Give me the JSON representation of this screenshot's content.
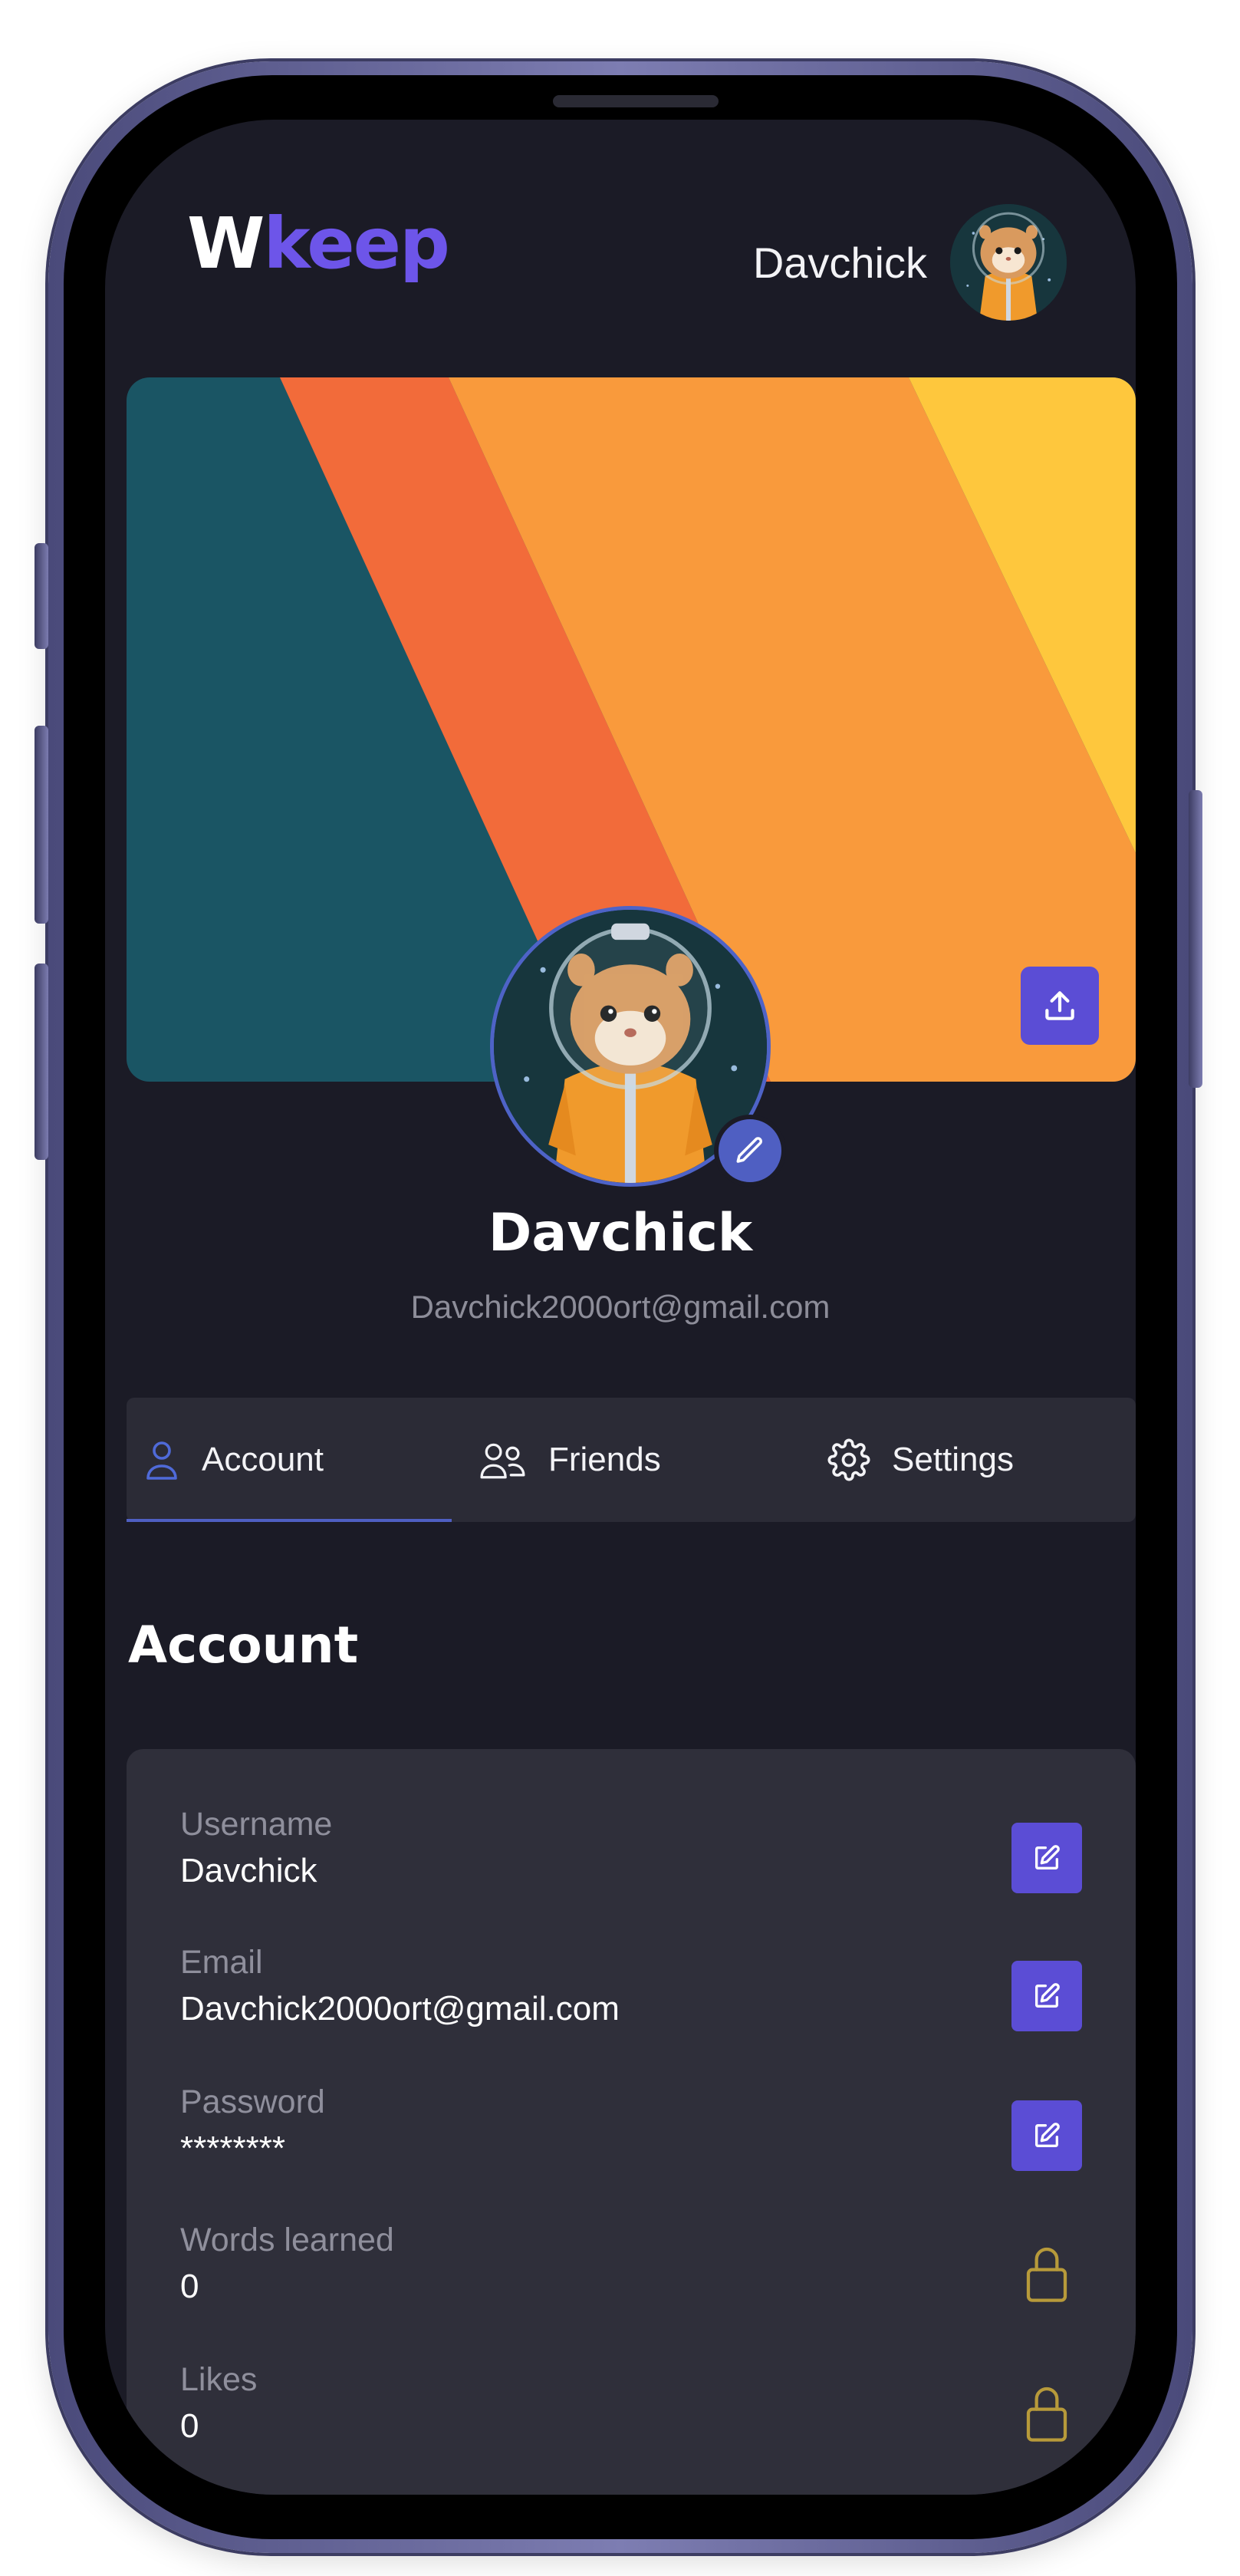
{
  "header": {
    "logo_part1": "W",
    "logo_part2": "keep",
    "username": "Davchick"
  },
  "banner": {
    "upload_icon": "upload-icon"
  },
  "profile": {
    "name": "Davchick",
    "email": "Davchick2000ort@gmail.com",
    "edit_icon": "pencil-icon"
  },
  "tabs": [
    {
      "label": "Account",
      "icon": "user-icon",
      "active": true
    },
    {
      "label": "Friends",
      "icon": "users-icon",
      "active": false
    },
    {
      "label": "Settings",
      "icon": "gear-icon",
      "active": false
    }
  ],
  "account": {
    "title": "Account",
    "fields": [
      {
        "label": "Username",
        "value": "Davchick",
        "action": "edit"
      },
      {
        "label": "Email",
        "value": "Davchick2000ort@gmail.com",
        "action": "edit"
      },
      {
        "label": "Password",
        "value": "********",
        "action": "edit"
      },
      {
        "label": "Words learned",
        "value": "0",
        "action": "locked"
      },
      {
        "label": "Likes",
        "value": "0",
        "action": "locked"
      }
    ]
  },
  "colors": {
    "background": "#1b1b26",
    "accent": "#6d55e9",
    "button": "#5b4dd5",
    "card": "#2f2f3a",
    "lock": "#b79a3a",
    "banner_teal": "#1a5564",
    "banner_red": "#f26b3a",
    "banner_orange": "#f99a3c",
    "banner_yellow": "#fec73d"
  }
}
